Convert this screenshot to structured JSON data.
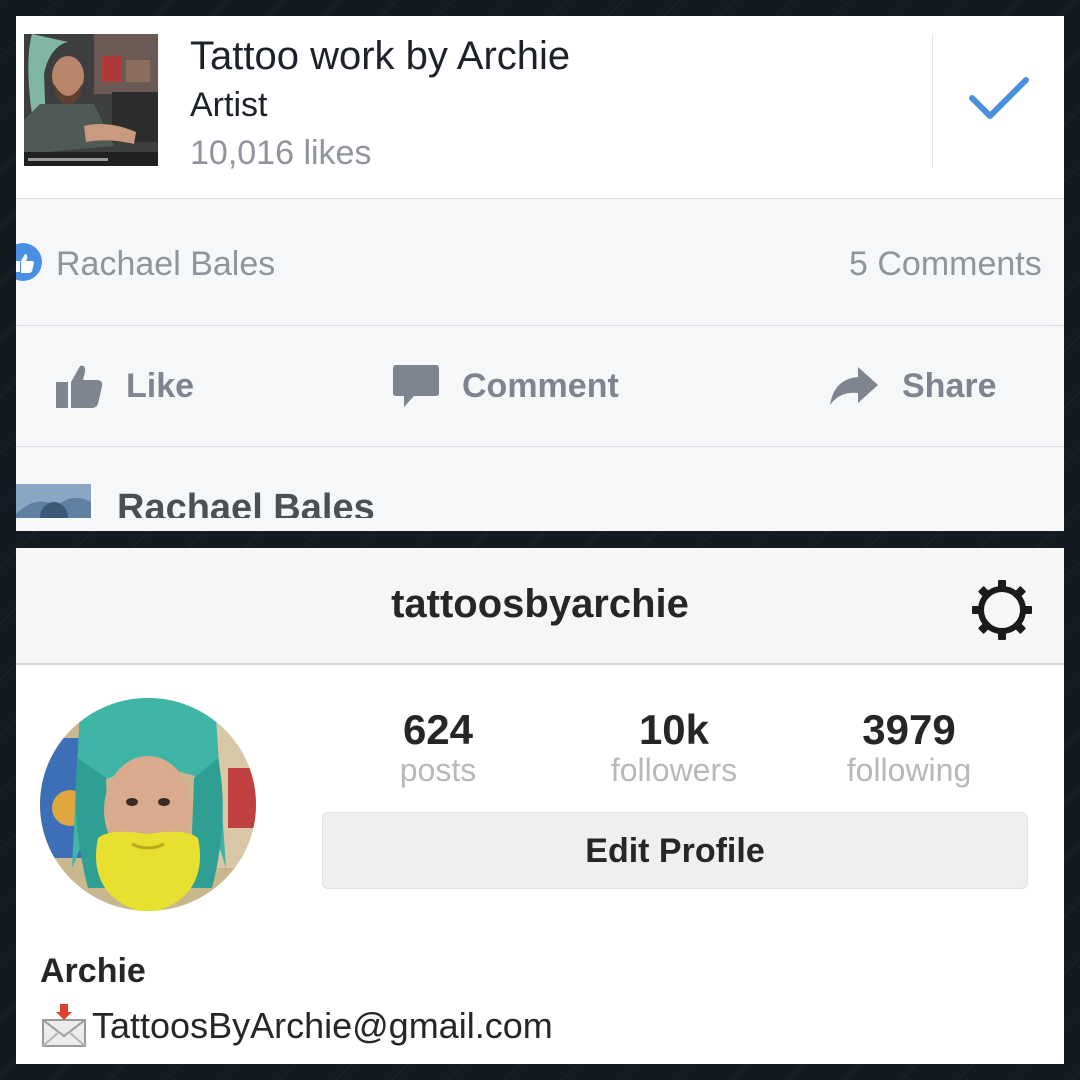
{
  "facebook": {
    "page_title": "Tattoo work by Archie",
    "page_category": "Artist",
    "page_likes": "10,016 likes",
    "liker": "Rachael Bales",
    "comments_count": "5 Comments",
    "actions": {
      "like": "Like",
      "comment": "Comment",
      "share": "Share"
    },
    "comment_author": "Rachael Bales",
    "accent_color": "#4a90e2"
  },
  "instagram": {
    "username": "tattoosbyarchie",
    "stats": [
      {
        "value": "624",
        "label": "posts"
      },
      {
        "value": "10k",
        "label": "followers"
      },
      {
        "value": "3979",
        "label": "following"
      }
    ],
    "edit_profile_label": "Edit Profile",
    "display_name": "Archie",
    "email": "TattoosByArchie@gmail.com"
  },
  "icons": [
    "check-icon",
    "like-badge-icon",
    "thumbs-up-icon",
    "comment-bubble-icon",
    "share-arrow-icon",
    "gear-icon",
    "incoming-envelope-icon"
  ]
}
